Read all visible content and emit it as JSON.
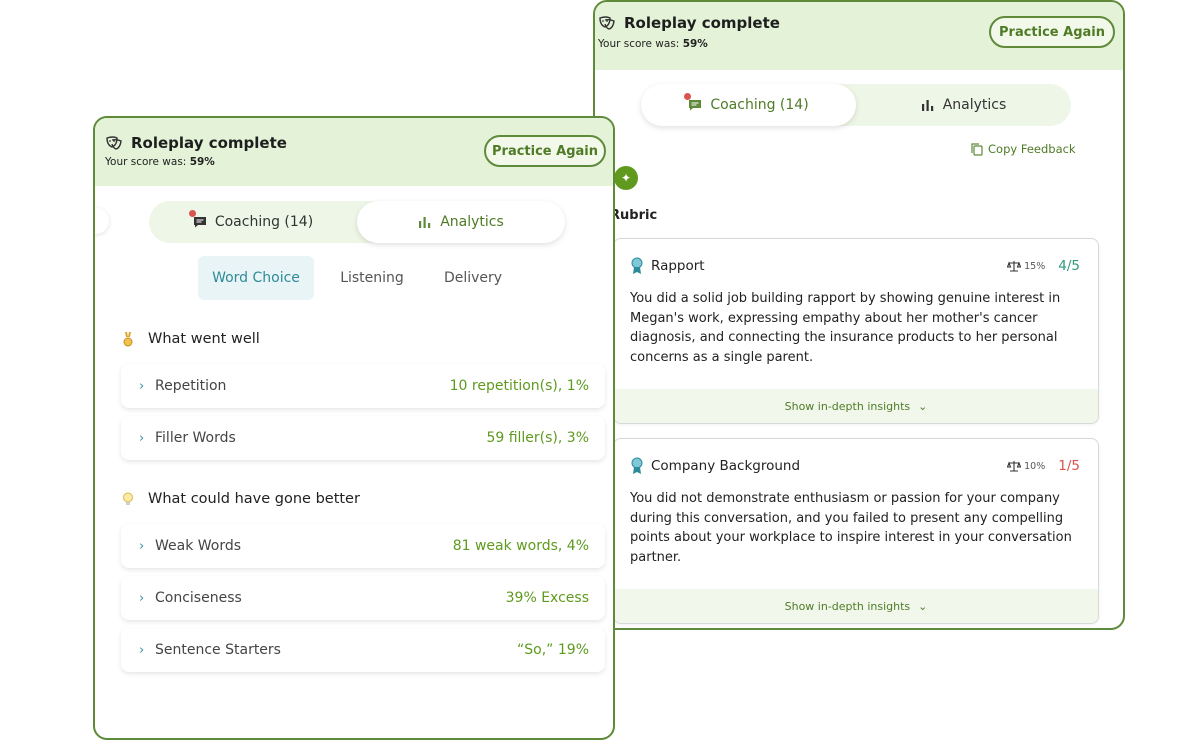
{
  "colors": {
    "accent_green": "#5e8a3a",
    "header_bg": "#e4f3d8",
    "good_value": "#5f9a1f",
    "bad_score": "#d9534f",
    "teal": "#2e8b99"
  },
  "back_panel": {
    "title": "Roleplay complete",
    "score_prefix": "Your score was:",
    "score_value": "59%",
    "practice_label": "Practice Again",
    "tabs": [
      {
        "label": "Coaching (14)",
        "icon": "chat-bubble-icon",
        "active": true
      },
      {
        "label": "Analytics",
        "icon": "bar-chart-icon",
        "active": false
      }
    ],
    "copy_feedback_label": "Copy Feedback",
    "rubric_label": "Rubric",
    "rubric_cards": [
      {
        "name": "Rapport",
        "weight": "15%",
        "score": "4/5",
        "score_color": "#2e9a7a",
        "text": "You did a solid job building rapport by showing genuine interest in Megan's work, expressing empathy about her mother's cancer diagnosis, and connecting the insurance products to her personal concerns as a single parent.",
        "insights_label": "Show in-depth insights"
      },
      {
        "name": "Company Background",
        "weight": "10%",
        "score": "1/5",
        "score_color": "#d9534f",
        "text": "You did not demonstrate enthusiasm or passion for your company during this conversation, and you failed to present any compelling points about your workplace to inspire interest in your conversation partner.",
        "insights_label": "Show in-depth insights"
      }
    ]
  },
  "front_panel": {
    "title": "Roleplay complete",
    "score_prefix": "Your score was:",
    "score_value": "59%",
    "practice_label": "Practice Again",
    "tabs": [
      {
        "label": "Coaching (14)",
        "icon": "chat-bubble-icon",
        "active": false
      },
      {
        "label": "Analytics",
        "icon": "bar-chart-icon",
        "active": true
      }
    ],
    "subtabs": [
      {
        "label": "Word Choice",
        "active": true
      },
      {
        "label": "Listening",
        "active": false
      },
      {
        "label": "Delivery",
        "active": false
      }
    ],
    "went_well": {
      "title": "What went well",
      "icon": "medal-icon",
      "items": [
        {
          "label": "Repetition",
          "value": "10 repetition(s), 1%"
        },
        {
          "label": "Filler Words",
          "value": "59 filler(s), 3%"
        }
      ]
    },
    "could_be_better": {
      "title": "What could have gone better",
      "icon": "lightbulb-icon",
      "items": [
        {
          "label": "Weak Words",
          "value": "81 weak words, 4%"
        },
        {
          "label": "Conciseness",
          "value": "39% Excess"
        },
        {
          "label": "Sentence Starters",
          "value": "“So,” 19%"
        }
      ]
    }
  }
}
